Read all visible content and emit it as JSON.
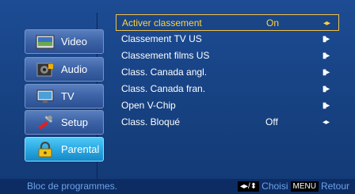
{
  "sidebar": {
    "items": [
      {
        "label": "Video",
        "icon": "video-icon"
      },
      {
        "label": "Audio",
        "icon": "audio-icon"
      },
      {
        "label": "TV",
        "icon": "tv-icon"
      },
      {
        "label": "Setup",
        "icon": "setup-icon"
      },
      {
        "label": "Parental",
        "icon": "lock-icon",
        "active": true
      }
    ]
  },
  "menu": {
    "rows": [
      {
        "label": "Activer classement",
        "value": "On",
        "control": "◂▸",
        "selected": true
      },
      {
        "label": "Classement TV US",
        "value": "",
        "control": "▮▸"
      },
      {
        "label": "Classement films US",
        "value": "",
        "control": "▮▸"
      },
      {
        "label": "Class. Canada angl.",
        "value": "",
        "control": "▮▸"
      },
      {
        "label": "Class. Canada fran.",
        "value": "",
        "control": "▮▸"
      },
      {
        "label": "Open V-Chip",
        "value": "",
        "control": "▮▸"
      },
      {
        "label": "Class. Bloqué",
        "value": "Off",
        "control": "◂▸"
      }
    ]
  },
  "footer": {
    "hint": "Bloc de programmes.",
    "nav_badge": "◂▸/⬍",
    "nav_label": "Choisi",
    "menu_badge": "MENU",
    "menu_label": "Retour"
  },
  "colors": {
    "background": "#173e7c",
    "selected_text": "#ffd33b",
    "selected_border": "#f1c04a",
    "active_item": "#2aa9e3",
    "hint_text": "#6ea4e6"
  }
}
